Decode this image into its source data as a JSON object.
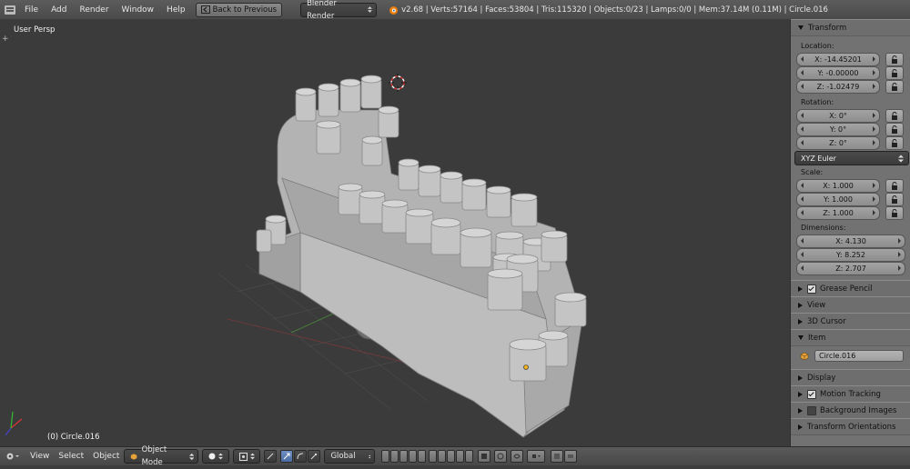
{
  "menus": {
    "file": "File",
    "add": "Add",
    "render": "Render",
    "window": "Window",
    "help": "Help"
  },
  "back_button": "Back to Previous",
  "render_engine": "Blender Render",
  "stats": "v2.68 | Verts:57164 | Faces:53804 | Tris:115320 | Objects:0/23 | Lamps:0/0 | Mem:37.14M (0.11M) | Circle.016",
  "viewport": {
    "view_name": "User Persp",
    "object_label": "(0) Circle.016"
  },
  "panel": {
    "transform_header": "Transform",
    "location_label": "Location:",
    "location": [
      "X: -14.45201",
      "Y: -0.00000",
      "Z: -1.02479"
    ],
    "rotation_label": "Rotation:",
    "rotation": [
      "X: 0°",
      "Y: 0°",
      "Z: 0°"
    ],
    "rotation_mode": "XYZ Euler",
    "scale_label": "Scale:",
    "scale": [
      "X: 1.000",
      "Y: 1.000",
      "Z: 1.000"
    ],
    "dimensions_label": "Dimensions:",
    "dimensions": [
      "X: 4.130",
      "Y: 8.252",
      "Z: 2.707"
    ],
    "grease_pencil": "Grease Pencil",
    "view": "View",
    "cursor": "3D Cursor",
    "item": "Item",
    "item_name": "Circle.016",
    "display": "Display",
    "motion_tracking": "Motion Tracking",
    "background_images": "Background Images",
    "transform_orientations": "Transform Orientations"
  },
  "bottom": {
    "view": "View",
    "select": "Select",
    "object": "Object",
    "mode": "Object Mode",
    "orientation": "Global"
  },
  "colors": {
    "viewport_bg": "#3b3b3b",
    "panel_bg": "#727272",
    "model_gray": "#b2b2b2",
    "header_bg": "#4f4f4f"
  }
}
